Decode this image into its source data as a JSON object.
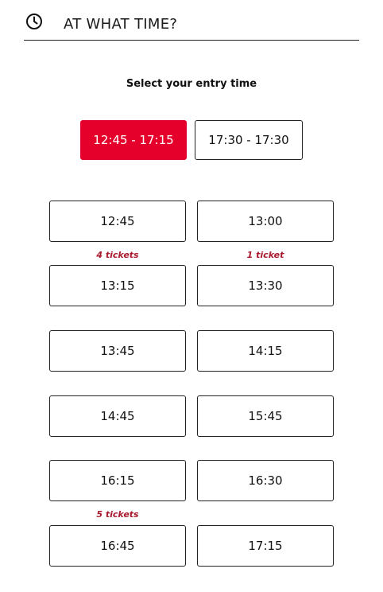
{
  "header": {
    "title": "AT WHAT TIME?",
    "icon": "clock-icon"
  },
  "subtitle": "Select your entry time",
  "ranges": [
    {
      "label": "12:45 - 17:15",
      "selected": true
    },
    {
      "label": "17:30 - 17:30",
      "selected": false
    }
  ],
  "slots": [
    {
      "time": "12:45",
      "note": "4 tickets"
    },
    {
      "time": "13:00",
      "note": "1 ticket"
    },
    {
      "time": "13:15",
      "note": ""
    },
    {
      "time": "13:30",
      "note": ""
    },
    {
      "time": "13:45",
      "note": ""
    },
    {
      "time": "14:15",
      "note": ""
    },
    {
      "time": "14:45",
      "note": ""
    },
    {
      "time": "15:45",
      "note": ""
    },
    {
      "time": "16:15",
      "note": "5 tickets"
    },
    {
      "time": "16:30",
      "note": ""
    },
    {
      "time": "16:45",
      "note": ""
    },
    {
      "time": "17:15",
      "note": ""
    }
  ],
  "colors": {
    "accent": "#e4002b",
    "note": "#a8192e",
    "border": "#222222"
  }
}
